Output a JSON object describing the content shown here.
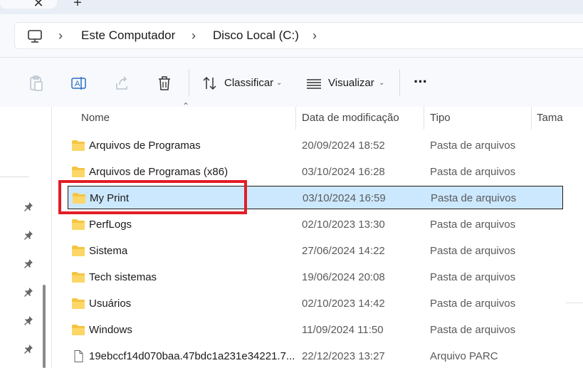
{
  "tabs": {
    "close_glyph": "✕",
    "new_tab_glyph": "+"
  },
  "address": {
    "icon": "computer-icon",
    "crumbs": [
      "Este Computador",
      "Disco Local (C:)"
    ],
    "separator": "›"
  },
  "toolbar": {
    "sort_label": "Classificar",
    "view_label": "Visualizar",
    "more_glyph": "···",
    "icons": [
      "paste-icon",
      "rename-icon",
      "share-icon",
      "delete-icon",
      "sort-icon",
      "view-icon"
    ]
  },
  "columns": {
    "name": "Nome",
    "date": "Data de modificação",
    "type": "Tipo",
    "size": "Taman"
  },
  "rows": [
    {
      "name": "Arquivos de Programas",
      "date": "20/09/2024 18:52",
      "type": "Pasta de arquivos",
      "kind": "folder"
    },
    {
      "name": "Arquivos de Programas (x86)",
      "date": "03/10/2024 16:28",
      "type": "Pasta de arquivos",
      "kind": "folder"
    },
    {
      "name": "My Print",
      "date": "03/10/2024 16:59",
      "type": "Pasta de arquivos",
      "kind": "folder",
      "selected": true
    },
    {
      "name": "PerfLogs",
      "date": "02/10/2023 13:30",
      "type": "Pasta de arquivos",
      "kind": "folder"
    },
    {
      "name": "Sistema",
      "date": "27/06/2024 14:22",
      "type": "Pasta de arquivos",
      "kind": "folder"
    },
    {
      "name": "Tech sistemas",
      "date": "19/06/2024 20:08",
      "type": "Pasta de arquivos",
      "kind": "folder"
    },
    {
      "name": "Usuários",
      "date": "02/10/2023 14:42",
      "type": "Pasta de arquivos",
      "kind": "folder"
    },
    {
      "name": "Windows",
      "date": "11/09/2024 11:50",
      "type": "Pasta de arquivos",
      "kind": "folder"
    },
    {
      "name": "19ebccf14d070baa.47bdc1a231e34221.7...",
      "date": "22/12/2023 13:27",
      "type": "Arquivo PARC",
      "kind": "file"
    }
  ],
  "colors": {
    "selection": "#cce8ff",
    "highlight": "#e11d26",
    "folder": "#f5c542"
  }
}
